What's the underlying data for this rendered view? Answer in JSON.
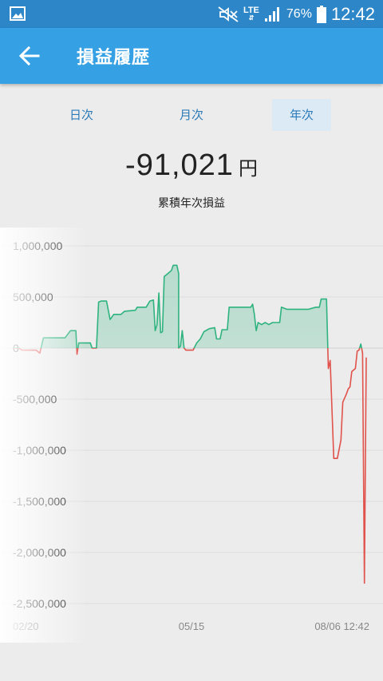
{
  "status_bar": {
    "network": "LTE",
    "battery": "76%",
    "time": "12:42",
    "icons": [
      "gallery-icon",
      "mute-icon",
      "signal-icon",
      "battery-icon"
    ]
  },
  "app_bar": {
    "title": "損益履歴",
    "back_icon": "arrow-left-icon"
  },
  "tabs": [
    {
      "label": "日次",
      "active": false
    },
    {
      "label": "月次",
      "active": false
    },
    {
      "label": "年次",
      "active": true
    }
  ],
  "summary": {
    "value": "-91,021",
    "unit": "円",
    "label": "累積年次損益"
  },
  "colors": {
    "positive": "#2eb37f",
    "negative": "#e0524b",
    "accent": "#36a0e4"
  },
  "chart_data": {
    "type": "line",
    "xlabel": "",
    "ylabel": "",
    "x_tick_labels": [
      "02/20",
      "05/15",
      "08/06 12:42"
    ],
    "y_tick_labels": [
      "1,000,000",
      "500,000",
      "0",
      "-500,000",
      "-1,000,000",
      "-1,500,000",
      "-2,000,000",
      "-2,500,000"
    ],
    "ylim": [
      -2500000,
      1000000
    ],
    "grid": true,
    "series": [
      {
        "values": [
          [
            0,
            0
          ],
          [
            0.01,
            0
          ],
          [
            0.018,
            0
          ],
          [
            0.025,
            -20000
          ],
          [
            0.04,
            -20000
          ],
          [
            0.055,
            -20000
          ],
          [
            0.065,
            -20000
          ],
          [
            0.075,
            -50000
          ],
          [
            0.085,
            100000
          ],
          [
            0.1,
            100000
          ],
          [
            0.12,
            100000
          ],
          [
            0.145,
            100000
          ],
          [
            0.16,
            170000
          ],
          [
            0.175,
            170000
          ],
          [
            0.178,
            -60000
          ],
          [
            0.183,
            50000
          ],
          [
            0.2,
            50000
          ],
          [
            0.215,
            50000
          ],
          [
            0.22,
            0
          ],
          [
            0.232,
            0
          ],
          [
            0.238,
            450000
          ],
          [
            0.245,
            460000
          ],
          [
            0.26,
            460000
          ],
          [
            0.27,
            280000
          ],
          [
            0.28,
            330000
          ],
          [
            0.3,
            330000
          ],
          [
            0.31,
            360000
          ],
          [
            0.34,
            370000
          ],
          [
            0.345,
            400000
          ],
          [
            0.37,
            400000
          ],
          [
            0.38,
            460000
          ],
          [
            0.39,
            470000
          ],
          [
            0.395,
            170000
          ],
          [
            0.4,
            230000
          ],
          [
            0.405,
            540000
          ],
          [
            0.41,
            150000
          ],
          [
            0.415,
            160000
          ],
          [
            0.42,
            700000
          ],
          [
            0.43,
            730000
          ],
          [
            0.44,
            760000
          ],
          [
            0.445,
            810000
          ],
          [
            0.455,
            810000
          ],
          [
            0.46,
            730000
          ],
          [
            0.46,
            0
          ],
          [
            0.465,
            20000
          ],
          [
            0.47,
            170000
          ],
          [
            0.475,
            0
          ],
          [
            0.48,
            -20000
          ],
          [
            0.5,
            -20000
          ],
          [
            0.51,
            50000
          ],
          [
            0.52,
            90000
          ],
          [
            0.53,
            160000
          ],
          [
            0.545,
            190000
          ],
          [
            0.56,
            200000
          ],
          [
            0.565,
            90000
          ],
          [
            0.575,
            90000
          ],
          [
            0.58,
            180000
          ],
          [
            0.595,
            180000
          ],
          [
            0.6,
            400000
          ],
          [
            0.62,
            400000
          ],
          [
            0.63,
            400000
          ],
          [
            0.66,
            400000
          ],
          [
            0.665,
            430000
          ],
          [
            0.67,
            330000
          ],
          [
            0.675,
            170000
          ],
          [
            0.68,
            250000
          ],
          [
            0.69,
            230000
          ],
          [
            0.7,
            250000
          ],
          [
            0.71,
            230000
          ],
          [
            0.72,
            250000
          ],
          [
            0.74,
            250000
          ],
          [
            0.745,
            400000
          ],
          [
            0.76,
            380000
          ],
          [
            0.79,
            380000
          ],
          [
            0.82,
            380000
          ],
          [
            0.84,
            400000
          ],
          [
            0.85,
            400000
          ],
          [
            0.855,
            480000
          ],
          [
            0.87,
            480000
          ],
          [
            0.875,
            -200000
          ],
          [
            0.88,
            -120000
          ],
          [
            0.89,
            -1080000
          ],
          [
            0.9,
            -1080000
          ],
          [
            0.91,
            -900000
          ],
          [
            0.915,
            -530000
          ],
          [
            0.925,
            -450000
          ],
          [
            0.93,
            -400000
          ],
          [
            0.935,
            -380000
          ],
          [
            0.94,
            -230000
          ],
          [
            0.95,
            -200000
          ],
          [
            0.955,
            -30000
          ],
          [
            0.96,
            -20000
          ],
          [
            0.965,
            40000
          ],
          [
            0.97,
            -50000
          ],
          [
            0.975,
            -2300000
          ],
          [
            0.98,
            -91021
          ]
        ]
      }
    ]
  }
}
